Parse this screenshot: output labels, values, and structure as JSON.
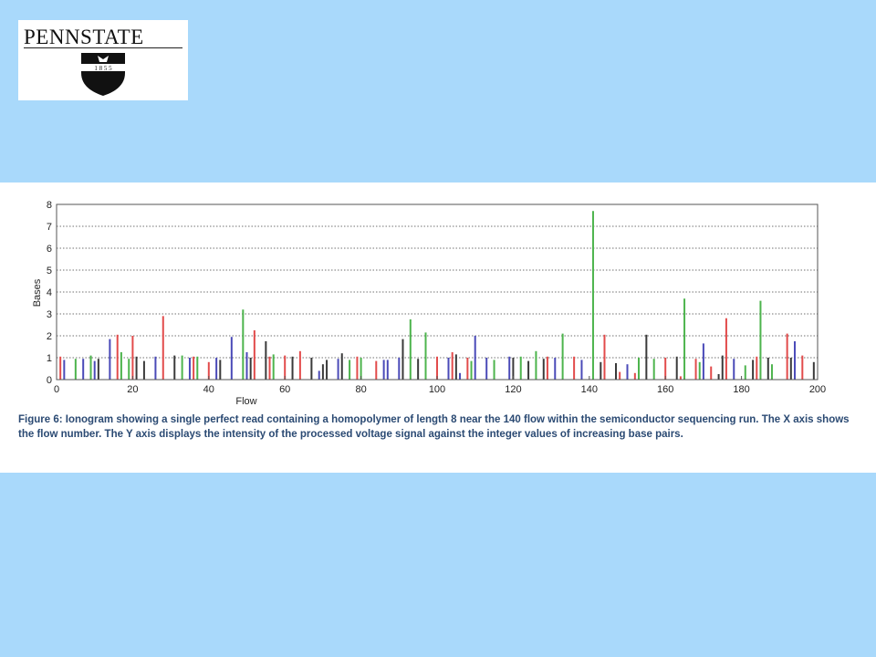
{
  "logo": {
    "wordmark": "PENNSTATE",
    "year": "1 8 5 5"
  },
  "figure": {
    "caption": "Figure 6:  Ionogram showing a single perfect read containing a homopolymer of length 8 near the 140 flow within the semiconductor sequencing run.  The X axis shows the flow number.  The Y axis displays the intensity of the processed voltage signal against the integer values of increasing base pairs."
  },
  "colors": {
    "background": "#a9d9fb",
    "red": "#e24b4b",
    "green": "#4db44d",
    "blue": "#4a4ab8",
    "black": "#3a3a3a"
  },
  "chart_data": {
    "type": "bar",
    "xlabel": "Flow",
    "ylabel": "Bases",
    "xlim": [
      0,
      200
    ],
    "ylim": [
      0,
      8
    ],
    "xticks": [
      0,
      20,
      40,
      60,
      80,
      100,
      120,
      140,
      160,
      180,
      200
    ],
    "yticks": [
      0,
      1,
      2,
      3,
      4,
      5,
      6,
      7,
      8
    ],
    "grid": "horizontal dotted",
    "bars": [
      {
        "x": 1,
        "y": 1.05,
        "c": "red"
      },
      {
        "x": 2,
        "y": 0.9,
        "c": "blue"
      },
      {
        "x": 5,
        "y": 0.95,
        "c": "green"
      },
      {
        "x": 7,
        "y": 0.95,
        "c": "blue"
      },
      {
        "x": 9,
        "y": 1.1,
        "c": "green"
      },
      {
        "x": 10,
        "y": 0.85,
        "c": "blue"
      },
      {
        "x": 11,
        "y": 0.95,
        "c": "black"
      },
      {
        "x": 14,
        "y": 1.85,
        "c": "blue"
      },
      {
        "x": 16,
        "y": 2.05,
        "c": "red"
      },
      {
        "x": 17,
        "y": 1.25,
        "c": "green"
      },
      {
        "x": 19,
        "y": 0.95,
        "c": "green"
      },
      {
        "x": 20,
        "y": 2.0,
        "c": "red"
      },
      {
        "x": 21,
        "y": 1.05,
        "c": "black"
      },
      {
        "x": 23,
        "y": 0.85,
        "c": "black"
      },
      {
        "x": 26,
        "y": 1.05,
        "c": "blue"
      },
      {
        "x": 28,
        "y": 2.9,
        "c": "red"
      },
      {
        "x": 31,
        "y": 1.1,
        "c": "black"
      },
      {
        "x": 33,
        "y": 1.1,
        "c": "green"
      },
      {
        "x": 35,
        "y": 1.0,
        "c": "blue"
      },
      {
        "x": 36,
        "y": 1.05,
        "c": "red"
      },
      {
        "x": 37,
        "y": 1.05,
        "c": "green"
      },
      {
        "x": 40,
        "y": 0.8,
        "c": "red"
      },
      {
        "x": 42,
        "y": 1.0,
        "c": "blue"
      },
      {
        "x": 43,
        "y": 0.9,
        "c": "black"
      },
      {
        "x": 46,
        "y": 1.95,
        "c": "blue"
      },
      {
        "x": 49,
        "y": 3.2,
        "c": "green"
      },
      {
        "x": 50,
        "y": 1.25,
        "c": "blue"
      },
      {
        "x": 51,
        "y": 1.0,
        "c": "black"
      },
      {
        "x": 52,
        "y": 2.25,
        "c": "red"
      },
      {
        "x": 55,
        "y": 1.75,
        "c": "black"
      },
      {
        "x": 56,
        "y": 1.05,
        "c": "red"
      },
      {
        "x": 57,
        "y": 1.15,
        "c": "green"
      },
      {
        "x": 60,
        "y": 1.1,
        "c": "red"
      },
      {
        "x": 62,
        "y": 1.05,
        "c": "black"
      },
      {
        "x": 64,
        "y": 1.3,
        "c": "red"
      },
      {
        "x": 67,
        "y": 1.0,
        "c": "black"
      },
      {
        "x": 69,
        "y": 0.4,
        "c": "blue"
      },
      {
        "x": 70,
        "y": 0.7,
        "c": "black"
      },
      {
        "x": 71,
        "y": 0.9,
        "c": "black"
      },
      {
        "x": 74,
        "y": 0.95,
        "c": "blue"
      },
      {
        "x": 75,
        "y": 1.2,
        "c": "black"
      },
      {
        "x": 77,
        "y": 0.9,
        "c": "green"
      },
      {
        "x": 79,
        "y": 1.05,
        "c": "red"
      },
      {
        "x": 80,
        "y": 1.0,
        "c": "green"
      },
      {
        "x": 84,
        "y": 0.85,
        "c": "red"
      },
      {
        "x": 86,
        "y": 0.9,
        "c": "blue"
      },
      {
        "x": 87,
        "y": 0.9,
        "c": "blue"
      },
      {
        "x": 90,
        "y": 1.0,
        "c": "blue"
      },
      {
        "x": 91,
        "y": 1.85,
        "c": "black"
      },
      {
        "x": 93,
        "y": 2.75,
        "c": "green"
      },
      {
        "x": 95,
        "y": 0.95,
        "c": "black"
      },
      {
        "x": 97,
        "y": 2.15,
        "c": "green"
      },
      {
        "x": 100,
        "y": 1.05,
        "c": "red"
      },
      {
        "x": 103,
        "y": 1.0,
        "c": "blue"
      },
      {
        "x": 104,
        "y": 1.25,
        "c": "red"
      },
      {
        "x": 105,
        "y": 1.15,
        "c": "black"
      },
      {
        "x": 106,
        "y": 0.3,
        "c": "blue"
      },
      {
        "x": 108,
        "y": 1.0,
        "c": "red"
      },
      {
        "x": 109,
        "y": 0.85,
        "c": "green"
      },
      {
        "x": 110,
        "y": 2.0,
        "c": "blue"
      },
      {
        "x": 113,
        "y": 1.0,
        "c": "blue"
      },
      {
        "x": 115,
        "y": 0.9,
        "c": "green"
      },
      {
        "x": 119,
        "y": 1.05,
        "c": "blue"
      },
      {
        "x": 120,
        "y": 1.0,
        "c": "black"
      },
      {
        "x": 122,
        "y": 1.05,
        "c": "green"
      },
      {
        "x": 124,
        "y": 0.85,
        "c": "black"
      },
      {
        "x": 126,
        "y": 1.3,
        "c": "green"
      },
      {
        "x": 128,
        "y": 0.95,
        "c": "black"
      },
      {
        "x": 129,
        "y": 1.05,
        "c": "red"
      },
      {
        "x": 131,
        "y": 1.0,
        "c": "blue"
      },
      {
        "x": 133,
        "y": 2.1,
        "c": "green"
      },
      {
        "x": 136,
        "y": 1.05,
        "c": "red"
      },
      {
        "x": 138,
        "y": 0.9,
        "c": "blue"
      },
      {
        "x": 141,
        "y": 7.7,
        "c": "green"
      },
      {
        "x": 143,
        "y": 0.8,
        "c": "black"
      },
      {
        "x": 144,
        "y": 2.05,
        "c": "red"
      },
      {
        "x": 147,
        "y": 0.75,
        "c": "black"
      },
      {
        "x": 148,
        "y": 0.35,
        "c": "red"
      },
      {
        "x": 150,
        "y": 0.7,
        "c": "blue"
      },
      {
        "x": 152,
        "y": 0.3,
        "c": "red"
      },
      {
        "x": 153,
        "y": 1.0,
        "c": "green"
      },
      {
        "x": 155,
        "y": 2.05,
        "c": "black"
      },
      {
        "x": 157,
        "y": 0.95,
        "c": "green"
      },
      {
        "x": 160,
        "y": 1.0,
        "c": "red"
      },
      {
        "x": 163,
        "y": 1.05,
        "c": "black"
      },
      {
        "x": 164,
        "y": 0.15,
        "c": "red"
      },
      {
        "x": 165,
        "y": 3.7,
        "c": "green"
      },
      {
        "x": 168,
        "y": 0.95,
        "c": "red"
      },
      {
        "x": 169,
        "y": 0.8,
        "c": "green"
      },
      {
        "x": 170,
        "y": 1.65,
        "c": "blue"
      },
      {
        "x": 172,
        "y": 0.6,
        "c": "red"
      },
      {
        "x": 174,
        "y": 0.25,
        "c": "black"
      },
      {
        "x": 175,
        "y": 1.1,
        "c": "black"
      },
      {
        "x": 176,
        "y": 2.8,
        "c": "red"
      },
      {
        "x": 178,
        "y": 0.95,
        "c": "blue"
      },
      {
        "x": 181,
        "y": 0.65,
        "c": "green"
      },
      {
        "x": 183,
        "y": 0.9,
        "c": "black"
      },
      {
        "x": 184,
        "y": 1.05,
        "c": "red"
      },
      {
        "x": 185,
        "y": 3.6,
        "c": "green"
      },
      {
        "x": 187,
        "y": 1.0,
        "c": "black"
      },
      {
        "x": 188,
        "y": 0.7,
        "c": "green"
      },
      {
        "x": 192,
        "y": 2.1,
        "c": "red"
      },
      {
        "x": 193,
        "y": 1.0,
        "c": "black"
      },
      {
        "x": 194,
        "y": 1.75,
        "c": "blue"
      },
      {
        "x": 196,
        "y": 1.1,
        "c": "red"
      },
      {
        "x": 199,
        "y": 0.8,
        "c": "black"
      }
    ]
  }
}
